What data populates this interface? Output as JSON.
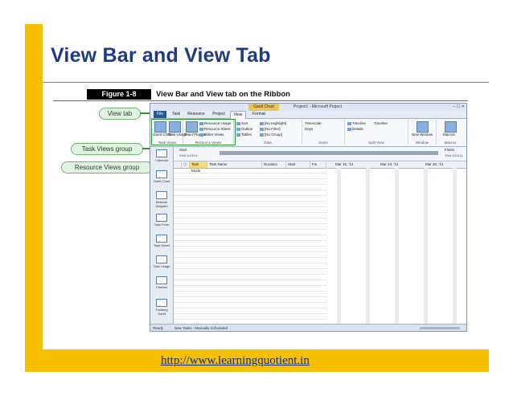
{
  "slide": {
    "title": "View Bar and View Tab",
    "footer_link": "http://www.learningquotient.in"
  },
  "figure": {
    "label": "Figure 1-8",
    "caption": "View Bar and View tab on the Ribbon",
    "callouts": {
      "view_tab": "View tab",
      "task_views": "Task Views group",
      "resource_views": "Resource Views group"
    }
  },
  "app": {
    "context_tab": "Gantt Chart Tools",
    "window_title": "Project1 - Microsoft Project",
    "tabs": [
      "File",
      "Task",
      "Resource",
      "Project",
      "View",
      "Format"
    ],
    "ribbon": {
      "task_views": {
        "gantt": "Gantt Chart",
        "usage": "Task Usage",
        "label": "Task Views"
      },
      "resource_views": {
        "planner": "Team Planner",
        "items": [
          "Resource Usage",
          "Resource Sheet",
          "Other Views"
        ],
        "label": "Resource Views"
      },
      "data": {
        "items": [
          "Sort",
          "Outline",
          "Tables",
          "[No Highlight]",
          "[No Filter]",
          "[No Group]"
        ],
        "label": "Data"
      },
      "zoom": {
        "items": [
          "Timescale:",
          "Days"
        ],
        "label": "Zoom"
      },
      "split_view": {
        "items": [
          "Timeline",
          "Timeline",
          "Details"
        ],
        "label": "Split View"
      },
      "window": {
        "item": "New Window",
        "label": "Window"
      },
      "macros": {
        "item": "Macros",
        "label": "Macros"
      }
    },
    "timeline": {
      "start": "Start",
      "start_date": "Wed 3/23/14",
      "finish": "Finish",
      "finish_date": "Wed 3/23/14"
    },
    "view_bar": [
      "Calendar",
      "Gantt Chart",
      "Network Diagram",
      "Task Form",
      "Task Sheet",
      "Task Usage",
      "Timeline",
      "Tracking Gantt"
    ],
    "grid_headers": {
      "mode": "Task Mode",
      "name": "Task Name",
      "duration": "Duration",
      "start": "Start",
      "fin": "Fin"
    },
    "gantt_weeks": [
      "Mar 16, '14",
      "Mar 23, '14",
      "Mar 30, '14"
    ],
    "status": {
      "ready": "Ready",
      "new_tasks": "New Tasks : Manually Scheduled"
    }
  }
}
